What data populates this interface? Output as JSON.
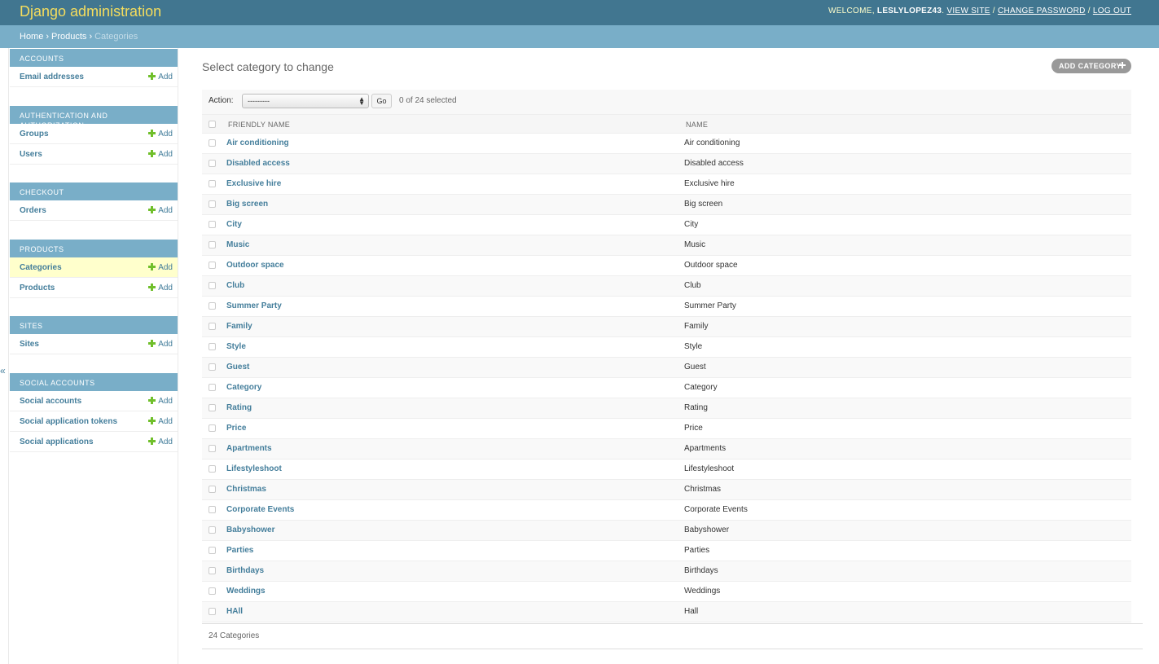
{
  "header": {
    "site_name": "Django administration",
    "welcome": "WELCOME, ",
    "username": "LESLYLOPEZ43",
    "view_site": "VIEW SITE",
    "change_password": "CHANGE PASSWORD",
    "log_out": "LOG OUT"
  },
  "breadcrumbs": {
    "home": "Home",
    "app": "Products",
    "current": "Categories",
    "separator": "›"
  },
  "sidebar": {
    "toggle": "«",
    "add_label": "Add",
    "modules": [
      {
        "caption": "Accounts",
        "items": [
          {
            "label": "Email addresses"
          }
        ]
      },
      {
        "caption": "Authentication and Authorization",
        "items": [
          {
            "label": "Groups"
          },
          {
            "label": "Users"
          }
        ]
      },
      {
        "caption": "Checkout",
        "items": [
          {
            "label": "Orders"
          }
        ]
      },
      {
        "caption": "Products",
        "items": [
          {
            "label": "Categories",
            "current": true
          },
          {
            "label": "Products"
          }
        ]
      },
      {
        "caption": "Sites",
        "items": [
          {
            "label": "Sites"
          }
        ]
      },
      {
        "caption": "Social Accounts",
        "items": [
          {
            "label": "Social accounts"
          },
          {
            "label": "Social application tokens"
          },
          {
            "label": "Social applications"
          }
        ]
      }
    ]
  },
  "main": {
    "title": "Select category to change",
    "add_button": "ADD CATEGORY",
    "action_label": "Action:",
    "action_selected": "---------",
    "go_button": "Go",
    "counter": "0 of 24 selected",
    "columns": [
      "FRIENDLY NAME",
      "NAME"
    ],
    "rows": [
      [
        "Air conditioning",
        "Air conditioning"
      ],
      [
        "Disabled access",
        "Disabled access"
      ],
      [
        "Exclusive hire",
        "Exclusive hire"
      ],
      [
        "Big screen",
        "Big screen"
      ],
      [
        "City",
        "City"
      ],
      [
        "Music",
        "Music"
      ],
      [
        "Outdoor space",
        "Outdoor space"
      ],
      [
        "Club",
        "Club"
      ],
      [
        "Summer Party",
        "Summer Party"
      ],
      [
        "Family",
        "Family"
      ],
      [
        "Style",
        "Style"
      ],
      [
        "Guest",
        "Guest"
      ],
      [
        "Category",
        "Category"
      ],
      [
        "Rating",
        "Rating"
      ],
      [
        "Price",
        "Price"
      ],
      [
        "Apartments",
        "Apartments"
      ],
      [
        "Lifestyleshoot",
        "Lifestyleshoot"
      ],
      [
        "Christmas",
        "Christmas"
      ],
      [
        "Corporate Events",
        "Corporate Events"
      ],
      [
        "Babyshower",
        "Babyshower"
      ],
      [
        "Parties",
        "Parties"
      ],
      [
        "Birthdays",
        "Birthdays"
      ],
      [
        "Weddings",
        "Weddings"
      ],
      [
        "HAll",
        "Hall"
      ]
    ],
    "paginator": "24 Categories"
  },
  "colors": {
    "header_bg": "#417690",
    "breadcrumb_bg": "#79aec8",
    "link": "#447e9b",
    "site_name": "#f5dd5d",
    "add_plus": "#70bf2b",
    "current_row": "#ffffcc"
  }
}
